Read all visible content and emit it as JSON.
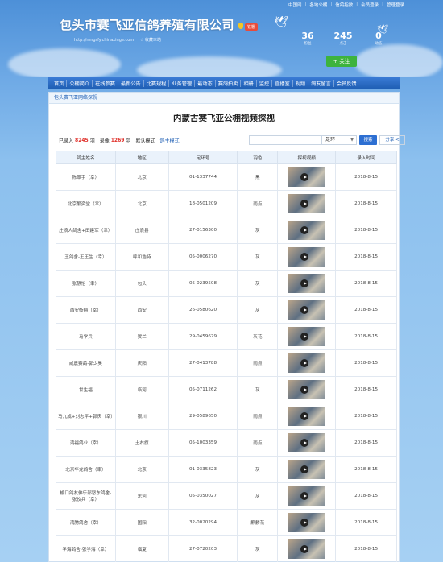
{
  "topbar": [
    "中国网",
    "各地公棚",
    "信鸽指数",
    "会员登录",
    "管理登录"
  ],
  "site": {
    "title": "包头市赛飞亚信鸽养殖有限公司",
    "badge": "铁棚",
    "url": "http://nmgsfy.chinaxinge.com",
    "fav": "收藏本站"
  },
  "stats": [
    {
      "num": "36",
      "label": "粉丝"
    },
    {
      "num": "245",
      "label": "点击"
    },
    {
      "num": "0",
      "label": "动态"
    }
  ],
  "follow_label": "+ 关注",
  "nav": [
    "首页",
    "公棚简介",
    "在线参赛",
    "最新公告",
    "比赛规程",
    "业务管理",
    "最动态",
    "赛鸽拍卖",
    "相册",
    "监控",
    "直播室",
    "视频",
    "鸽友留言",
    "会员反馈"
  ],
  "breadcrumb": "包头赛飞亚网络探视",
  "page_title": "内蒙古赛飞亚公棚视频探视",
  "filters": {
    "entered_label": "已录入",
    "entered_count": "8245",
    "entered_unit": "羽",
    "collected_label": "录像",
    "collected_count": "1269",
    "collected_unit": "羽",
    "default_mode": "默认模式",
    "owner_mode": "鸽主模式",
    "ring_option": "足环",
    "search_label": "搜索",
    "share_label": "分享"
  },
  "table": {
    "headers": [
      "鸽主姓名",
      "地区",
      "足环号",
      "羽色",
      "探视视频",
      "录入时间"
    ],
    "rows": [
      {
        "owner": "陈翠宇（幸）",
        "region": "北京",
        "ring": "01-1337744",
        "color": "黑",
        "date": "2018-8-15"
      },
      {
        "owner": "北京繁资堂（幸）",
        "region": "北京",
        "ring": "18-0501209",
        "color": "雨点",
        "date": "2018-8-15"
      },
      {
        "owner": "庄浪人鸽舍+田建军（幸）",
        "region": "庄浪县",
        "ring": "27-0156300",
        "color": "灰",
        "date": "2018-8-15"
      },
      {
        "owner": "王鸽舍-王王生（幸）",
        "region": "呼和浩特",
        "ring": "05-0006270",
        "color": "灰",
        "date": "2018-8-15"
      },
      {
        "owner": "张静怡（幸）",
        "region": "包头",
        "ring": "05-0239508",
        "color": "灰",
        "date": "2018-8-15"
      },
      {
        "owner": "西安衡翔（幸）",
        "region": "西安",
        "ring": "26-0580620",
        "color": "灰",
        "date": "2018-8-15"
      },
      {
        "owner": "马学兵",
        "region": "贺兰",
        "ring": "29-0459679",
        "color": "灰花",
        "date": "2018-8-15"
      },
      {
        "owner": "威震赛鸽-郭少昊",
        "region": "庆阳",
        "ring": "27-0413788",
        "color": "雨点",
        "date": "2018-8-15"
      },
      {
        "owner": "甘生福",
        "region": "临河",
        "ring": "05-0711262",
        "color": "灰",
        "date": "2018-8-15"
      },
      {
        "owner": "马九成+刘志平+郭庆（幸）",
        "region": "银川",
        "ring": "29-0589650",
        "color": "雨点",
        "date": "2018-8-15"
      },
      {
        "owner": "鸿福鸽业（幸）",
        "region": "土右旗",
        "ring": "05-1003359",
        "color": "雨点",
        "date": "2018-8-15"
      },
      {
        "owner": "北京华龙鸽舍（幸）",
        "region": "北京",
        "ring": "01-0335823",
        "color": "灰",
        "date": "2018-8-15"
      },
      {
        "owner": "榆口鸽友佛乐部怒东鸽舍-张佼兵（幸）",
        "region": "东河",
        "ring": "05-0350027",
        "color": "灰",
        "date": "2018-8-15"
      },
      {
        "owner": "鸿腾鸽舍（幸）",
        "region": "固阳",
        "ring": "32-0020294",
        "color": "麒麟花",
        "date": "2018-8-15"
      },
      {
        "owner": "学海鸽舍-张学海（幸）",
        "region": "临夏",
        "ring": "27-0720203",
        "color": "灰",
        "date": "2018-8-15"
      }
    ]
  }
}
